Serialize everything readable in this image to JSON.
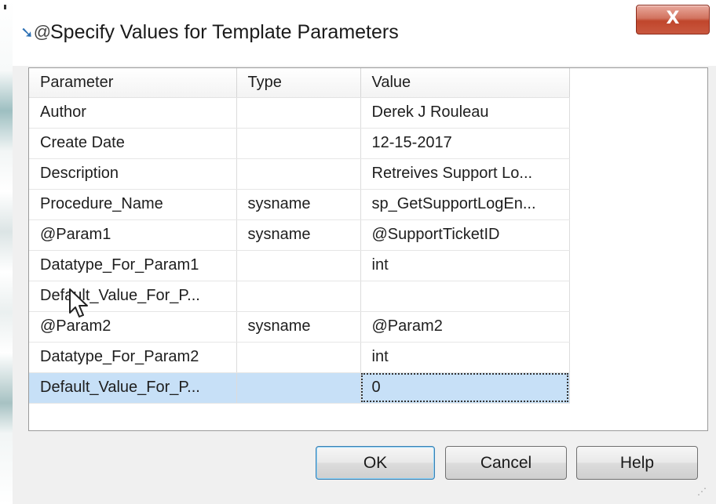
{
  "dialog": {
    "title": "Specify Values for Template Parameters",
    "close_label": "X"
  },
  "grid": {
    "columns": [
      "Parameter",
      "Type",
      "Value"
    ],
    "rows": [
      {
        "parameter": "Author",
        "type": "",
        "value": "Derek J Rouleau"
      },
      {
        "parameter": "Create Date",
        "type": "",
        "value": "12-15-2017"
      },
      {
        "parameter": "Description",
        "type": "",
        "value": "Retreives Support Lo..."
      },
      {
        "parameter": "Procedure_Name",
        "type": "sysname",
        "value": "sp_GetSupportLogEn..."
      },
      {
        "parameter": "@Param1",
        "type": "sysname",
        "value": "@SupportTicketID"
      },
      {
        "parameter": "Datatype_For_Param1",
        "type": "",
        "value": "int"
      },
      {
        "parameter": "Default_Value_For_P...",
        "type": "",
        "value": ""
      },
      {
        "parameter": "@Param2",
        "type": "sysname",
        "value": "@Param2"
      },
      {
        "parameter": "Datatype_For_Param2",
        "type": "",
        "value": "int"
      },
      {
        "parameter": "Default_Value_For_P...",
        "type": "",
        "value": "0"
      }
    ],
    "selected_row": 9
  },
  "buttons": {
    "ok": "OK",
    "cancel": "Cancel",
    "help": "Help"
  },
  "colors": {
    "selection": "#c7e0f7",
    "close_button": "#c9583f",
    "ok_border": "#3c7fb1"
  },
  "icons": {
    "title": "template-parameters-icon",
    "close": "close-icon",
    "cursor": "mouse-pointer-icon",
    "grip": "resize-grip-icon"
  }
}
